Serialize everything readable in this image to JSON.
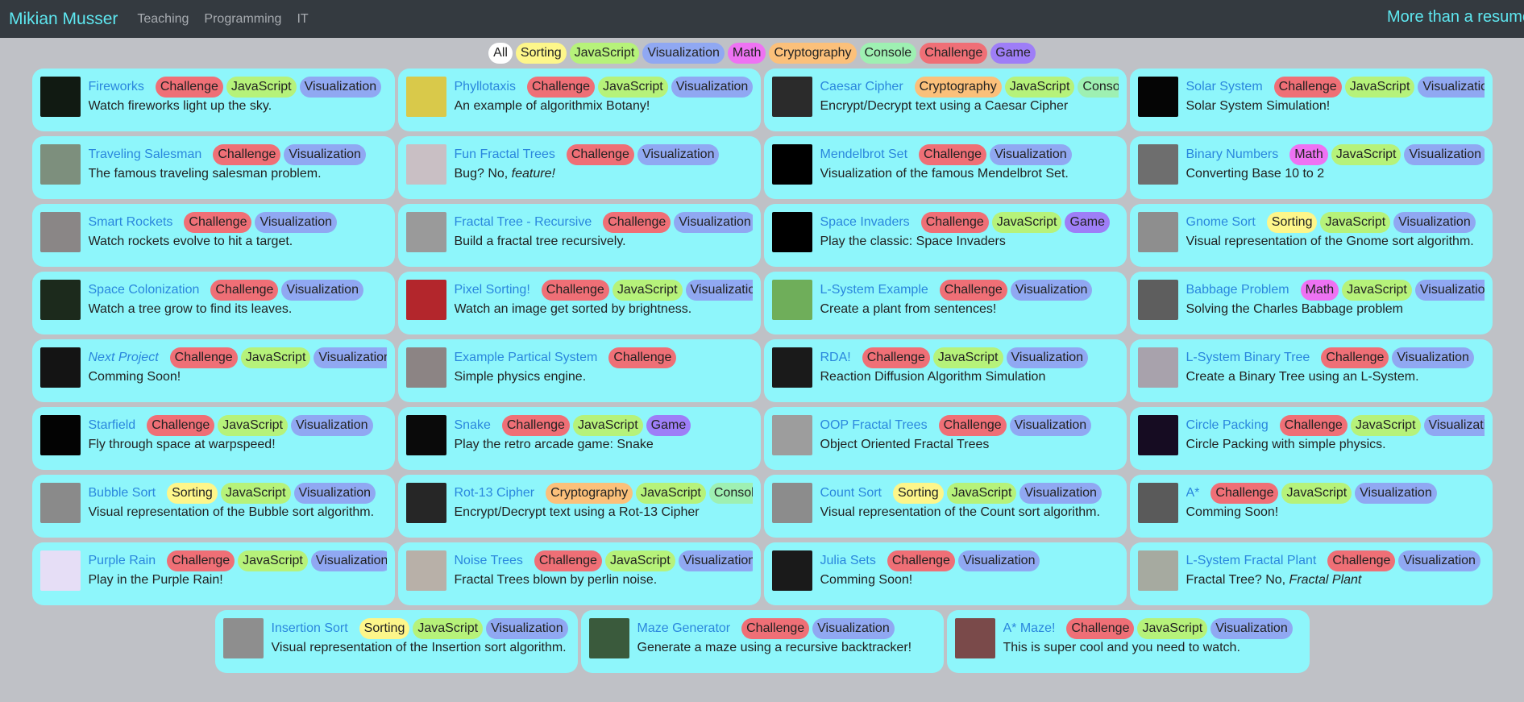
{
  "nav": {
    "brand": "Mikian Musser",
    "links": [
      "Teaching",
      "Programming",
      "IT"
    ],
    "slogan": "More than a resume"
  },
  "filters": [
    "All",
    "Sorting",
    "JavaScript",
    "Visualization",
    "Math",
    "Cryptography",
    "Console",
    "Challenge",
    "Game"
  ],
  "tag_colors": {
    "All": "#ffffff",
    "Sorting": "#fdf68a",
    "JavaScript": "#b6f27a",
    "Visualization": "#90a8f2",
    "Math": "#ee72f3",
    "Cryptography": "#fbc07a",
    "Console": "#9ef0b2",
    "Challenge": "#ef6f76",
    "Game": "#9e7ef7"
  },
  "projects": [
    {
      "title": "Fireworks",
      "tags": [
        "Challenge",
        "JavaScript",
        "Visualization"
      ],
      "desc": "Watch fireworks light up the sky.",
      "thumb": "#111a12"
    },
    {
      "title": "Phyllotaxis",
      "tags": [
        "Challenge",
        "JavaScript",
        "Visualization"
      ],
      "desc": "An example of algorithmix Botany!",
      "thumb": "#d9c94a"
    },
    {
      "title": "Caesar Cipher",
      "tags": [
        "Cryptography",
        "JavaScript",
        "Console"
      ],
      "desc": "Encrypt/Decrypt text using a Caesar Cipher",
      "thumb": "#2b2b2b"
    },
    {
      "title": "Solar System",
      "tags": [
        "Challenge",
        "JavaScript",
        "Visualization"
      ],
      "desc": "Solar System Simulation!",
      "thumb": "#050505"
    },
    {
      "title": "Traveling Salesman",
      "tags": [
        "Challenge",
        "Visualization"
      ],
      "desc": "The famous traveling salesman problem.",
      "thumb": "#7d8f7d"
    },
    {
      "title": "Fun Fractal Trees",
      "tags": [
        "Challenge",
        "Visualization"
      ],
      "desc": "Bug? No, ",
      "desc_em": "feature!",
      "thumb": "#c9bfc4"
    },
    {
      "title": "Mendelbrot Set",
      "tags": [
        "Challenge",
        "Visualization"
      ],
      "desc": "Visualization of the famous Mendelbrot Set.",
      "thumb": "#000000"
    },
    {
      "title": "Binary Numbers",
      "tags": [
        "Math",
        "JavaScript",
        "Visualization"
      ],
      "desc": "Converting Base 10 to 2",
      "thumb": "#6e6e6e"
    },
    {
      "title": "Smart Rockets",
      "tags": [
        "Challenge",
        "Visualization"
      ],
      "desc": "Watch rockets evolve to hit a target.",
      "thumb": "#8a8686"
    },
    {
      "title": "Fractal Tree - Recursive",
      "tags": [
        "Challenge",
        "Visualization"
      ],
      "desc": "Build a fractal tree recursively.",
      "thumb": "#9a9a9a"
    },
    {
      "title": "Space Invaders",
      "tags": [
        "Challenge",
        "JavaScript",
        "Game"
      ],
      "desc": "Play the classic: Space Invaders",
      "thumb": "#000000"
    },
    {
      "title": "Gnome Sort",
      "tags": [
        "Sorting",
        "JavaScript",
        "Visualization"
      ],
      "desc": "Visual representation of the Gnome sort algorithm.",
      "thumb": "#8e8e8e"
    },
    {
      "title": "Space Colonization",
      "tags": [
        "Challenge",
        "Visualization"
      ],
      "desc": "Watch a tree grow to find its leaves.",
      "thumb": "#1c2a1c"
    },
    {
      "title": "Pixel Sorting!",
      "tags": [
        "Challenge",
        "JavaScript",
        "Visualization"
      ],
      "desc": "Watch an image get sorted by brightness.",
      "thumb": "#b3262c"
    },
    {
      "title": "L-System Example",
      "tags": [
        "Challenge",
        "Visualization"
      ],
      "desc": "Create a plant from sentences!",
      "thumb": "#6fae5a"
    },
    {
      "title": "Babbage Problem",
      "tags": [
        "Math",
        "JavaScript",
        "Visualization"
      ],
      "desc": "Solving the Charles Babbage problem",
      "thumb": "#5e5e5e"
    },
    {
      "title": "Next Project",
      "italic": true,
      "tags": [
        "Challenge",
        "JavaScript",
        "Visualization"
      ],
      "desc": "Comming Soon!",
      "thumb": "#141414"
    },
    {
      "title": "Example Partical System",
      "tags": [
        "Challenge"
      ],
      "desc": "Simple physics engine.",
      "thumb": "#8c8484"
    },
    {
      "title": "RDA!",
      "tags": [
        "Challenge",
        "JavaScript",
        "Visualization"
      ],
      "desc": "Reaction Diffusion Algorithm Simulation",
      "thumb": "#1a1a1a"
    },
    {
      "title": "L-System Binary Tree",
      "tags": [
        "Challenge",
        "Visualization"
      ],
      "desc": "Create a Binary Tree using an L-System.",
      "thumb": "#a8a2ac"
    },
    {
      "title": "Starfield",
      "tags": [
        "Challenge",
        "JavaScript",
        "Visualization"
      ],
      "desc": "Fly through space at warpspeed!",
      "thumb": "#030303"
    },
    {
      "title": "Snake",
      "tags": [
        "Challenge",
        "JavaScript",
        "Game"
      ],
      "desc": "Play the retro arcade game: Snake",
      "thumb": "#0a0a0a"
    },
    {
      "title": "OOP Fractal Trees",
      "tags": [
        "Challenge",
        "Visualization"
      ],
      "desc": "Object Oriented Fractal Trees",
      "thumb": "#9d9d9d"
    },
    {
      "title": "Circle Packing",
      "tags": [
        "Challenge",
        "JavaScript",
        "Visualization"
      ],
      "desc": "Circle Packing with simple physics.",
      "thumb": "#160c22"
    },
    {
      "title": "Bubble Sort",
      "tags": [
        "Sorting",
        "JavaScript",
        "Visualization"
      ],
      "desc": "Visual representation of the Bubble sort algorithm.",
      "thumb": "#8a8a8a"
    },
    {
      "title": "Rot-13 Cipher",
      "tags": [
        "Cryptography",
        "JavaScript",
        "Console"
      ],
      "desc": "Encrypt/Decrypt text using a Rot-13 Cipher",
      "thumb": "#262626"
    },
    {
      "title": "Count Sort",
      "tags": [
        "Sorting",
        "JavaScript",
        "Visualization"
      ],
      "desc": "Visual representation of the Count sort algorithm.",
      "thumb": "#8c8c8c"
    },
    {
      "title": "A*",
      "tags": [
        "Challenge",
        "JavaScript",
        "Visualization"
      ],
      "desc": "Comming Soon!",
      "thumb": "#5a5a5a"
    },
    {
      "title": "Purple Rain",
      "tags": [
        "Challenge",
        "JavaScript",
        "Visualization"
      ],
      "desc": "Play in the Purple Rain!",
      "thumb": "#e6def6"
    },
    {
      "title": "Noise Trees",
      "tags": [
        "Challenge",
        "JavaScript",
        "Visualization"
      ],
      "desc": "Fractal Trees blown by perlin noise.",
      "thumb": "#b8b0a8"
    },
    {
      "title": "Julia Sets",
      "tags": [
        "Challenge",
        "Visualization"
      ],
      "desc": "Comming Soon!",
      "thumb": "#1a1a1a"
    },
    {
      "title": "L-System Fractal Plant",
      "tags": [
        "Challenge",
        "Visualization"
      ],
      "desc": "Fractal Tree? No, ",
      "desc_em": "Fractal Plant",
      "thumb": "#a6aaa0"
    },
    {
      "title": "Insertion Sort",
      "tags": [
        "Sorting",
        "JavaScript",
        "Visualization"
      ],
      "desc": "Visual representation of the Insertion sort algorithm.",
      "thumb": "#8e8e8e"
    },
    {
      "title": "Maze Generator",
      "tags": [
        "Challenge",
        "Visualization"
      ],
      "desc": "Generate a maze using a recursive backtracker!",
      "thumb": "#3a5a3c"
    },
    {
      "title": "A* Maze!",
      "tags": [
        "Challenge",
        "JavaScript",
        "Visualization"
      ],
      "desc": "This is super cool and you need to watch.",
      "thumb": "#7a4a4a"
    }
  ]
}
